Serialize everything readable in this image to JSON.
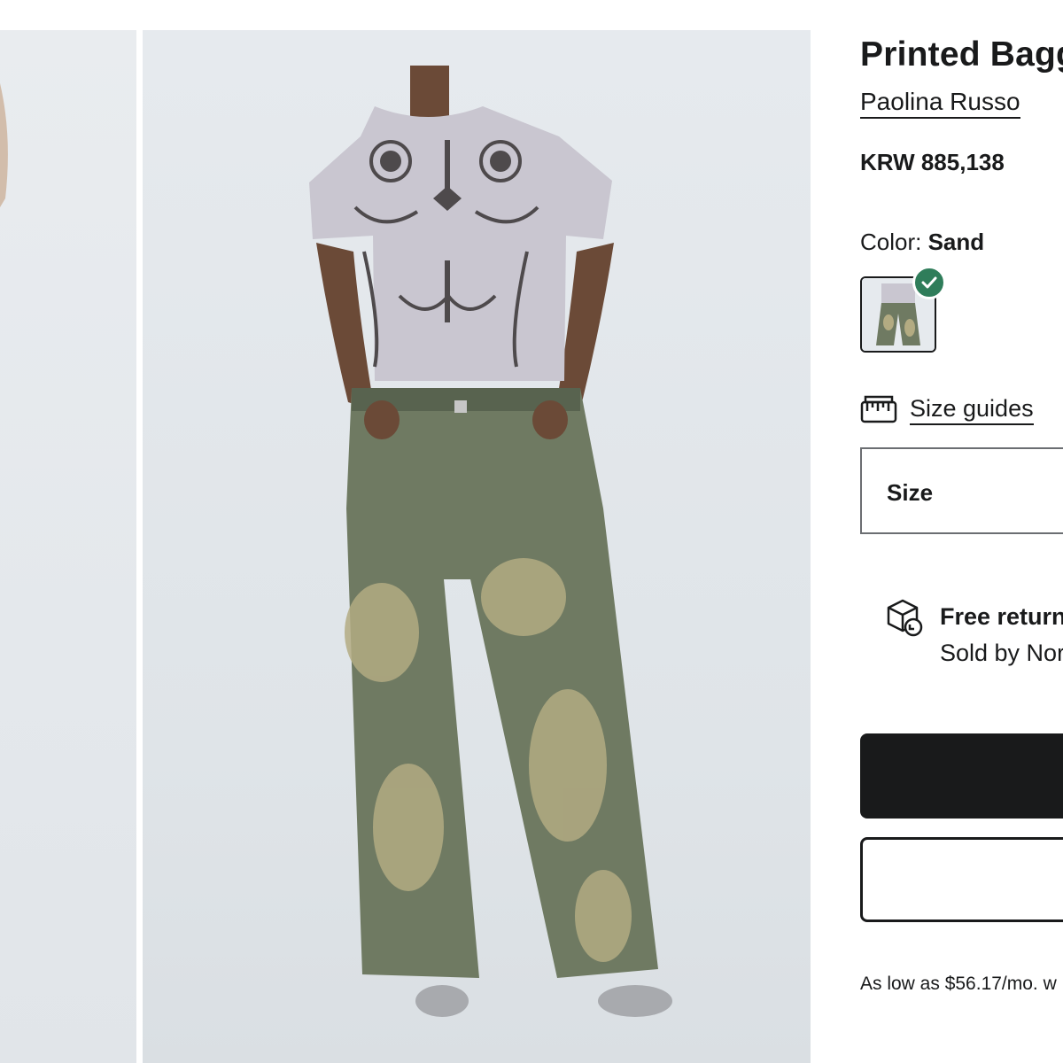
{
  "product": {
    "title": "Printed Bagg",
    "brand": "Paolina Russo",
    "price": "KRW 885,138"
  },
  "color": {
    "label": "Color: ",
    "value": "Sand"
  },
  "size_guides": {
    "icon": "ruler-icon",
    "label": "Size guides"
  },
  "size_select": {
    "label": "Size"
  },
  "returns": {
    "icon": "box-return-icon",
    "title": "Free returns",
    "subtitle": "Sold by Nor"
  },
  "financing": {
    "text": "As low as $56.17/mo. w"
  },
  "colors": {
    "selected_check": "#2f7d5a",
    "primary_button": "#191a1b"
  }
}
